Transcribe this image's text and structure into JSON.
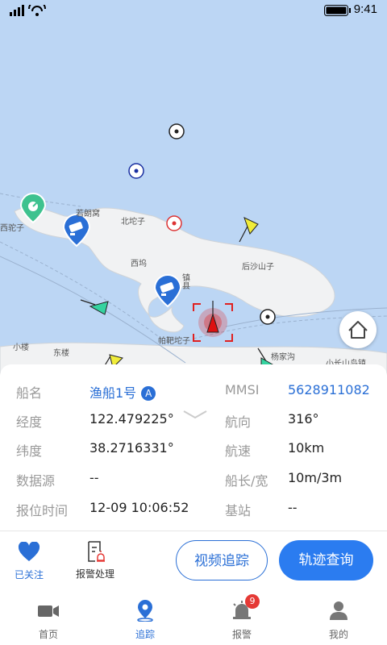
{
  "status_bar": {
    "time": "9:41"
  },
  "map": {
    "labels": {
      "xituozi": "西驼子",
      "ruolangou": "若朗窝",
      "beituozi": "北坨子",
      "xiwu": "西坞",
      "houshashanzi": "后沙山子",
      "zhen": "镇",
      "xian": "县",
      "yuchangtuozi": "帕靶坨子",
      "xiaolou": "小楼",
      "donglou": "东楼",
      "yangjiagou": "杨家沟",
      "xiaochangshandaozhen": "小长山岛镇"
    }
  },
  "vessel": {
    "name_label": "船名",
    "name_value": "渔船1号",
    "name_badge": "A",
    "mmsi_label": "MMSI",
    "mmsi_value": "5628911082",
    "lon_label": "经度",
    "lon_value": "122.479225°",
    "heading_label": "航向",
    "heading_value": "316°",
    "lat_label": "纬度",
    "lat_value": "38.2716331°",
    "speed_label": "航速",
    "speed_value": "10km",
    "source_label": "数据源",
    "source_value": "--",
    "size_label": "船长/宽",
    "size_value": "10m/3m",
    "report_time_label": "报位时间",
    "report_time_value": "12-09 10:06:52",
    "station_label": "基站",
    "station_value": "--"
  },
  "actions": {
    "follow_label": "已关注",
    "alarm_handle_label": "报警处理",
    "video_track_label": "视频追踪",
    "track_query_label": "轨迹查询"
  },
  "tabs": [
    {
      "label": "首页"
    },
    {
      "label": "追踪"
    },
    {
      "label": "报警",
      "badge": "9"
    },
    {
      "label": "我的"
    }
  ],
  "colors": {
    "accent": "#2a6fd6",
    "alarm": "#e53935",
    "vessel_target": "#e02020"
  }
}
